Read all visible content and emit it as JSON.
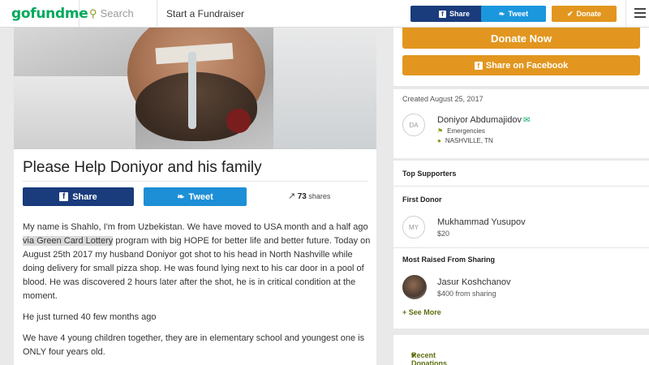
{
  "nav": {
    "logo": "gofundme",
    "search_placeholder": "Search",
    "start_link": "Start a Fundraiser",
    "share_label": "Share",
    "tweet_label": "Tweet",
    "donate_label": "Donate"
  },
  "campaign": {
    "title": "Please Help Doniyor and his family",
    "share_label": "Share",
    "tweet_label": "Tweet",
    "shares_count": "73",
    "shares_label": "shares",
    "story": {
      "p1_before": "My name is Shahlo, I'm from Uzbekistan. We have moved to USA month and a half ago ",
      "p1_highlight": "via Green Card Lottery",
      "p1_after": " program with big HOPE for better life and better future. Today on August 25th 2017 my husband Doniyor got shot to his head in North Nashville while doing delivery for small pizza shop. He was found lying next to his car door in a pool of blood.  He was discovered 2 hours later after the shot, he is in critical condition at the moment.",
      "p2": "He just turned 40 few months ago",
      "p3": "We have 4 young children together, they are in elementary school and youngest one is ONLY four years old."
    }
  },
  "sidebar": {
    "donate_now": "Donate Now",
    "share_facebook": "Share on Facebook",
    "created": "Created August 25, 2017",
    "organizer": {
      "initials": "DA",
      "name": "Doniyor Abdumajidov",
      "category": "Emergencies",
      "location": "NASHVILLE, TN"
    },
    "top_supporters": "Top Supporters",
    "first_donor": {
      "heading": "First Donor",
      "initials": "MY",
      "name": "Mukhammad Yusupov",
      "amount": "$20"
    },
    "most_raised": {
      "heading": "Most Raised From Sharing",
      "name": "Jasur Koshchanov",
      "amount": "$400 from sharing"
    },
    "see_more": "+ See More",
    "recent_donations": "Recent Donations"
  },
  "colors": {
    "brand_green": "#02a95c",
    "facebook_blue": "#1a3b7c",
    "twitter_blue": "#1b97dd",
    "donate_orange": "#e2961f",
    "link_olive": "#5b6e10"
  }
}
